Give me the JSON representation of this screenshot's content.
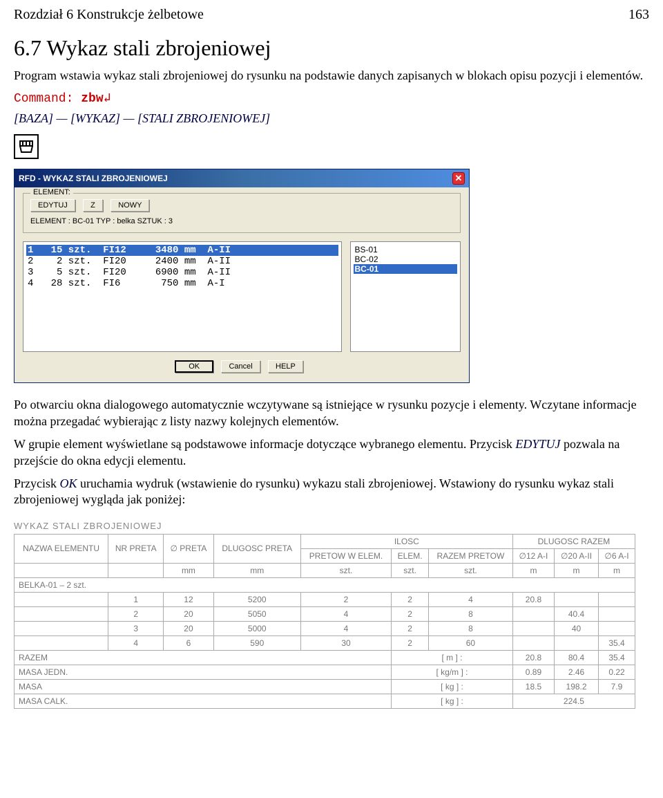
{
  "header": {
    "left": "Rozdział 6 Konstrukcje żelbetowe",
    "right": "163"
  },
  "h1": "6.7 Wykaz stali zbrojeniowej",
  "intro": "Program wstawia wykaz stali zbrojeniowej do rysunku na podstawie danych zapisanych w blokach opisu pozycji i elementów.",
  "command": {
    "prefix": "Command: ",
    "cmd": "zbw",
    "enter": "↲"
  },
  "menu": "[BAZA] — [WYKAZ] — [STALI ZBROJENIOWEJ]",
  "dialog": {
    "title": "RFD - WYKAZ STALI ZBROJENIOWEJ",
    "groupLabel": "ELEMENT:",
    "buttons": {
      "edit": "EDYTUJ",
      "z": "Z",
      "new": "NOWY"
    },
    "info": "ELEMENT : BC-01 TYP : belka SZTUK : 3",
    "rows": [
      "1   15 szt.  FI12     3480 mm  A-II",
      "2    2 szt.  FI20     2400 mm  A-II",
      "3    5 szt.  FI20     6900 mm  A-II",
      "4   28 szt.  FI6       750 mm  A-I"
    ],
    "side": [
      "BS-01",
      "BC-02",
      "BC-01"
    ],
    "ok": "OK",
    "cancel": "Cancel",
    "help": "HELP"
  },
  "para1": "Po otwarciu okna dialogowego automatycznie wczytywane są istniejące w rysunku pozycje i elementy. Wczytane informacje można przegadać wybierając z listy nazwy kolejnych elementów.",
  "para2a": "W grupie element wyświetlane są podstawowe informacje dotyczące wybranego elementu. Przycisk ",
  "para2edit": "EDYTUJ",
  "para2b": " pozwala na przejście do okna edycji elementu.",
  "para3a": "Przycisk ",
  "para3ok": "OK",
  "para3b": " uruchamia wydruk (wstawienie do rysunku) wykazu stali zbrojeniowej. Wstawiony do rysunku wykaz stali zbrojeniowej wygląda jak poniżej:",
  "wykazTitle": "WYKAZ STALI ZBROJENIOWEJ",
  "table": {
    "h_nazwa": "NAZWA ELEMENTU",
    "h_nr": "NR PRETA",
    "h_fi": "∅ PRETA",
    "h_dlug": "DLUGOSC PRETA",
    "h_ilosc": "ILOSC",
    "h_pretow": "PRETOW W ELEM.",
    "h_elem": "ELEM.",
    "h_razempr": "RAZEM PRETOW",
    "h_dlugrazem": "DLUGOSC RAZEM",
    "h_f12": "∅12 A-I",
    "h_f20": "∅20 A-II",
    "h_f6": "∅6 A-I",
    "u_mm": "mm",
    "u_szt": "szt.",
    "u_m": "m",
    "group": "BELKA-01 – 2 szt.",
    "rows": [
      {
        "nr": "1",
        "fi": "12",
        "dl": "5200",
        "pw": "2",
        "el": "2",
        "rp": "4",
        "f12": "20.8",
        "f20": "",
        "f6": ""
      },
      {
        "nr": "2",
        "fi": "20",
        "dl": "5050",
        "pw": "4",
        "el": "2",
        "rp": "8",
        "f12": "",
        "f20": "40.4",
        "f6": ""
      },
      {
        "nr": "3",
        "fi": "20",
        "dl": "5000",
        "pw": "4",
        "el": "2",
        "rp": "8",
        "f12": "",
        "f20": "40",
        "f6": ""
      },
      {
        "nr": "4",
        "fi": "6",
        "dl": "590",
        "pw": "30",
        "el": "2",
        "rp": "60",
        "f12": "",
        "f20": "",
        "f6": "35.4"
      }
    ],
    "sum": {
      "razem_l": "RAZEM",
      "razem_u": "[ m ] :",
      "razem": [
        "20.8",
        "80.4",
        "35.4"
      ],
      "mj_l": "MASA JEDN.",
      "mj_u": "[ kg/m ] :",
      "mj": [
        "0.89",
        "2.46",
        "0.22"
      ],
      "m_l": "MASA",
      "m_u": "[ kg ] :",
      "m": [
        "18.5",
        "198.2",
        "7.9"
      ],
      "mc_l": "MASA CALK.",
      "mc_u": "[ kg ] :",
      "mc": "224.5"
    }
  }
}
